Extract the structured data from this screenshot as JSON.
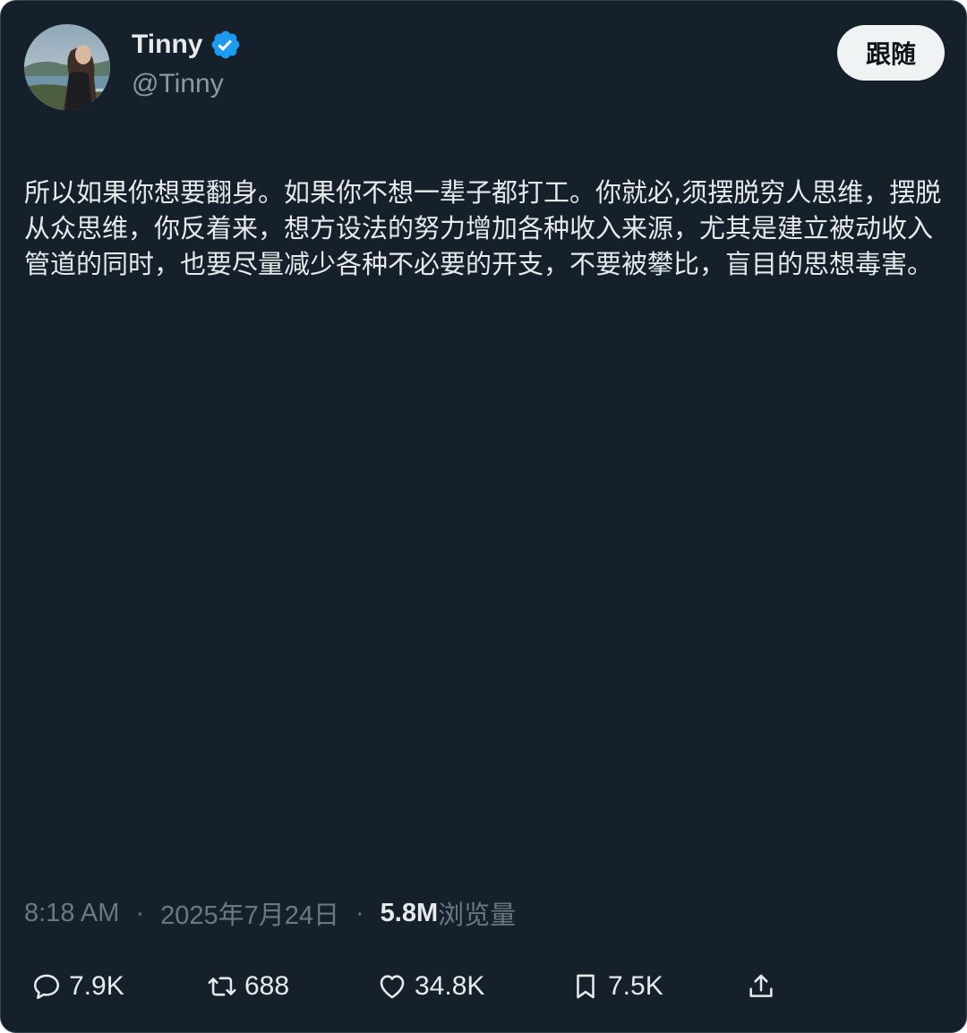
{
  "author": {
    "display_name": "Tinny",
    "handle": "@Tinny",
    "verified_icon": "verified-badge-icon",
    "avatar_icon": "avatar"
  },
  "follow_button": {
    "label": "跟随"
  },
  "tweet": {
    "text": "所以如果你想要翻身。如果你不想一辈子都打工。你就必,须摆脱穷人思维，摆脱从众思维，你反着来，想方设法的努力增加各种收入来源，尤其是建立被动收入管道的同时，也要尽量减少各种不必要的开支，不要被攀比，盲目的思想毒害。"
  },
  "meta": {
    "time": "8:18 AM",
    "separator": "·",
    "date": "2025年7月24日",
    "views_count": "5.8M",
    "views_label": "浏览量"
  },
  "actions": {
    "reply": {
      "icon": "reply-icon",
      "count": "7.9K"
    },
    "retweet": {
      "icon": "retweet-icon",
      "count": "688"
    },
    "like": {
      "icon": "heart-icon",
      "count": "34.8K"
    },
    "bookmark": {
      "icon": "bookmark-icon",
      "count": "7.5K"
    },
    "share": {
      "icon": "share-icon"
    }
  },
  "colors": {
    "background": "#15202b",
    "text_primary": "#e7e9ea",
    "text_secondary": "#6b7884",
    "verified_blue": "#1d9bf0",
    "button_bg": "#eff3f4"
  }
}
